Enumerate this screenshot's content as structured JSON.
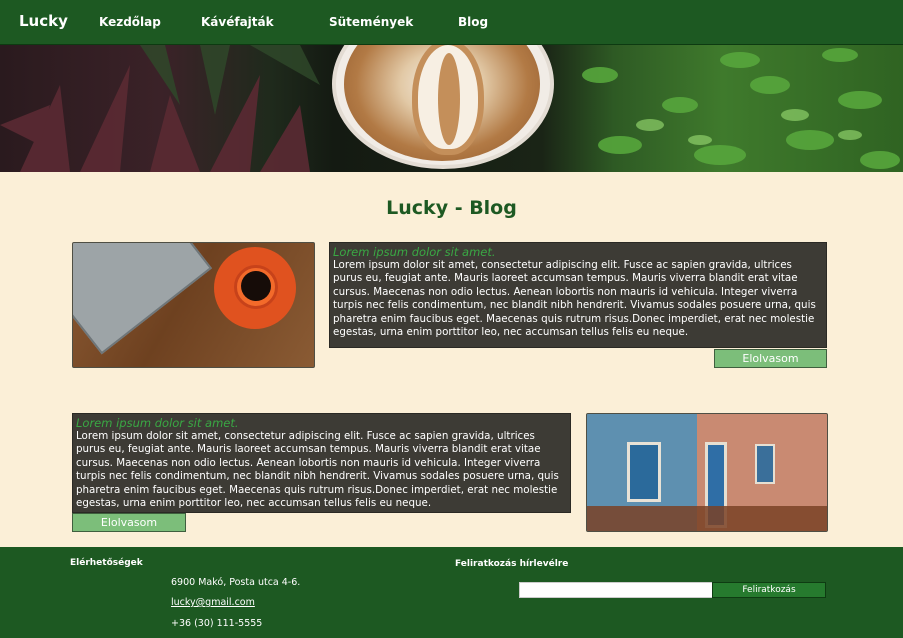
{
  "nav": {
    "brand": "Lucky",
    "items": [
      "Kezdőlap",
      "Kávéfajták",
      "Sütemények",
      "Blog"
    ]
  },
  "page": {
    "title": "Lucky - Blog"
  },
  "posts": [
    {
      "heading": "Lorem ipsum dolor sit amet.",
      "text": "Lorem ipsum dolor sit amet, consectetur adipiscing elit. Fusce ac sapien gravida, ultrices purus eu, feugiat ante. Mauris laoreet accumsan tempus. Mauris viverra blandit erat vitae cursus. Maecenas non odio lectus. Aenean lobortis non mauris id vehicula. Integer viverra turpis nec felis condimentum, nec blandit nibh hendrerit. Vivamus sodales posuere urna, quis pharetra enim faucibus eget. Maecenas quis rutrum risus.Donec imperdiet, erat nec molestie egestas, urna enim porttitor leo, nec accumsan tellus felis eu neque.",
      "button": "Elolvasom"
    },
    {
      "heading": "Lorem ipsum dolor sit amet.",
      "text": "Lorem ipsum dolor sit amet, consectetur adipiscing elit. Fusce ac sapien gravida, ultrices purus eu, feugiat ante. Mauris laoreet accumsan tempus. Mauris viverra blandit erat vitae cursus. Maecenas non odio lectus. Aenean lobortis non mauris id vehicula. Integer viverra turpis nec felis condimentum, nec blandit nibh hendrerit. Vivamus sodales posuere urna, quis pharetra enim faucibus eget. Maecenas quis rutrum risus.Donec imperdiet, erat nec molestie egestas, urna enim porttitor leo, nec accumsan tellus felis eu neque.",
      "button": "Elolvasom"
    }
  ],
  "footer": {
    "contact_title": "Elérhetőségek",
    "address": "6900 Makó, Posta utca 4-6.",
    "email": "lucky@gmail.com",
    "phone": "+36 (30) 111-5555",
    "newsletter_title": "Feliratkozás hírlevélre",
    "newsletter_placeholder": "",
    "subscribe_label": "Feliratkozás"
  },
  "colors": {
    "brand_green": "#1d5922",
    "heading_green": "#3aa844",
    "button_green": "#7cbe7a",
    "page_bg": "#fbefd7"
  }
}
